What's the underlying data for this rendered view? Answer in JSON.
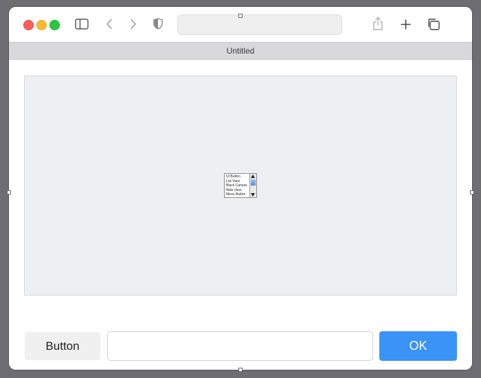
{
  "window": {
    "tab_title": "Untitled",
    "url": ""
  },
  "toolbar": {
    "icons": [
      "sidebar-icon",
      "back-icon",
      "forward-icon",
      "shield-icon",
      "share-icon",
      "new-tab-icon",
      "tab-overview-icon"
    ]
  },
  "listbox": {
    "items": [
      "UI Button",
      "List View",
      "Black Canvas",
      "Web View",
      "Menu Button"
    ],
    "thumb_color": "#4a8ee0"
  },
  "footer": {
    "button_label": "Button",
    "input_value": "",
    "input_placeholder": "",
    "ok_label": "OK",
    "ok_color": "#3a93f7"
  }
}
